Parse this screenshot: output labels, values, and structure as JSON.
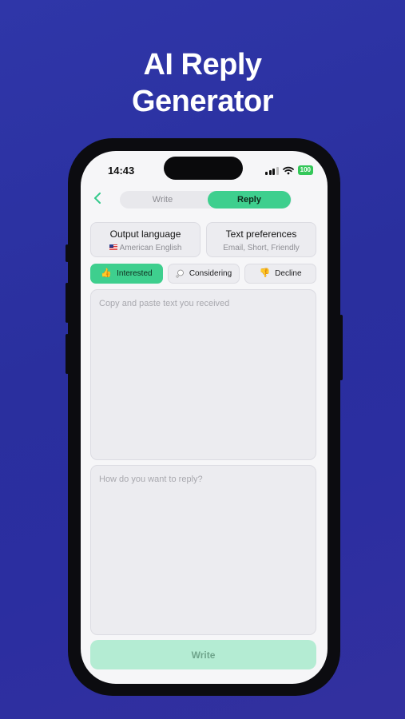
{
  "headline": {
    "line1": "AI Reply",
    "line2": "Generator"
  },
  "status_bar": {
    "time": "14:43",
    "battery": "100"
  },
  "segment": {
    "write_label": "Write",
    "reply_label": "Reply",
    "selected": "Reply"
  },
  "output_language": {
    "title": "Output language",
    "value": "American English"
  },
  "text_preferences": {
    "title": "Text preferences",
    "value": "Email, Short, Friendly"
  },
  "intents": [
    {
      "label": "Interested",
      "icon": "thumbs-up-icon",
      "selected": true
    },
    {
      "label": "Considering",
      "icon": "thought-bubble-icon",
      "selected": false
    },
    {
      "label": "Decline",
      "icon": "thumbs-down-icon",
      "selected": false
    }
  ],
  "received_input": {
    "placeholder": "Copy and paste text you received"
  },
  "reply_input": {
    "placeholder": "How do you want to reply?"
  },
  "primary_action": {
    "label": "Write"
  },
  "colors": {
    "background": "#2b2fa0",
    "accent": "#3ecf8e",
    "button_disabled": "#b4ecd3"
  }
}
